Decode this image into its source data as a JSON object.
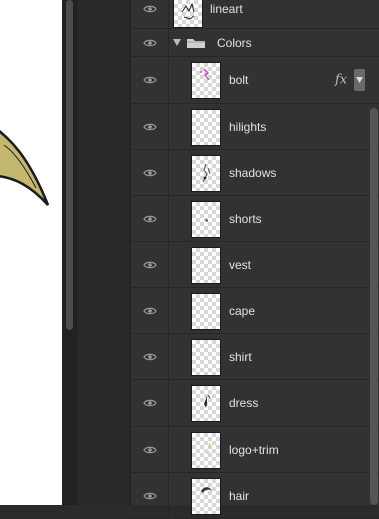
{
  "layers_panel": {
    "top_layer": {
      "label": "lineart"
    },
    "group": {
      "label": "Colors",
      "expanded": true
    },
    "layers": [
      {
        "label": "bolt",
        "has_fx": true,
        "fx_label": "fx",
        "thumb_icon": "bolt-art"
      },
      {
        "label": "hilights",
        "has_fx": false,
        "thumb_icon": "hilights-art"
      },
      {
        "label": "shadows",
        "has_fx": false,
        "thumb_icon": "shadows-art"
      },
      {
        "label": "shorts",
        "has_fx": false,
        "thumb_icon": "shorts-art"
      },
      {
        "label": "vest",
        "has_fx": false,
        "thumb_icon": "vest-art"
      },
      {
        "label": "cape",
        "has_fx": false,
        "thumb_icon": "cape-art"
      },
      {
        "label": "shirt",
        "has_fx": false,
        "thumb_icon": "shirt-art"
      },
      {
        "label": "dress",
        "has_fx": false,
        "thumb_icon": "dress-art"
      },
      {
        "label": "logo+trim",
        "has_fx": false,
        "thumb_icon": "logo-trim-art"
      },
      {
        "label": "hair",
        "has_fx": false,
        "thumb_icon": "hair-art"
      }
    ]
  },
  "colors": {
    "panel_bg": "#323232",
    "row_divider": "#272727",
    "text": "#e2e2e2",
    "canvas_art_fill": "#c4b86e",
    "canvas_art_stroke": "#1a1a1a"
  }
}
